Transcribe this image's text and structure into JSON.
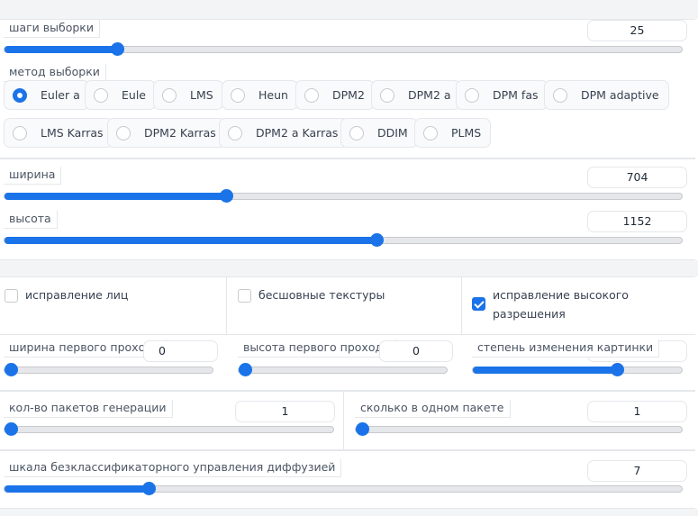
{
  "steps": {
    "label": "шаги выборки",
    "value": "25",
    "fraction": 0.166
  },
  "sampler": {
    "label": "метод выборки",
    "selected": "Euler a",
    "options": [
      "Euler a",
      "Eule",
      "LMS",
      "Heun",
      "DPM2",
      "DPM2 a",
      "DPM fas",
      "DPM adaptive",
      "LMS Karras",
      "DPM2 Karras",
      "DPM2 a Karras",
      "DDIM",
      "PLMS"
    ]
  },
  "width": {
    "label": "ширина",
    "value": "704",
    "fraction": 0.326
  },
  "height": {
    "label": "высота",
    "value": "1152",
    "fraction": 0.545
  },
  "checkboxes": {
    "face_fix": {
      "label": "исправление лиц",
      "checked": false
    },
    "tiling": {
      "label": "бесшовные текстуры",
      "checked": false
    },
    "hires": {
      "label_line1": "исправление высокого",
      "label_line2": "разрешения",
      "checked": true
    }
  },
  "firstpass_width": {
    "label": "ширина первого прохода",
    "value": "0",
    "fraction": 0.0
  },
  "firstpass_height": {
    "label": "высота первого прохода",
    "value": "0",
    "fraction": 0.0
  },
  "denoise": {
    "label": "степень изменения картинки",
    "value": "",
    "fraction": 0.7
  },
  "batch_count": {
    "label": "кол-во пакетов генерации",
    "value": "1",
    "fraction": 0.0
  },
  "batch_size": {
    "label": "сколько в одном пакете",
    "value": "1",
    "fraction": 0.0
  },
  "cfg": {
    "label": "шкала безклассификаторного управления диффузией",
    "value": "7",
    "fraction": 0.207
  },
  "colors": {
    "accent": "#1a73e8",
    "track": "#e5e7eb",
    "border": "#e5e7eb"
  }
}
